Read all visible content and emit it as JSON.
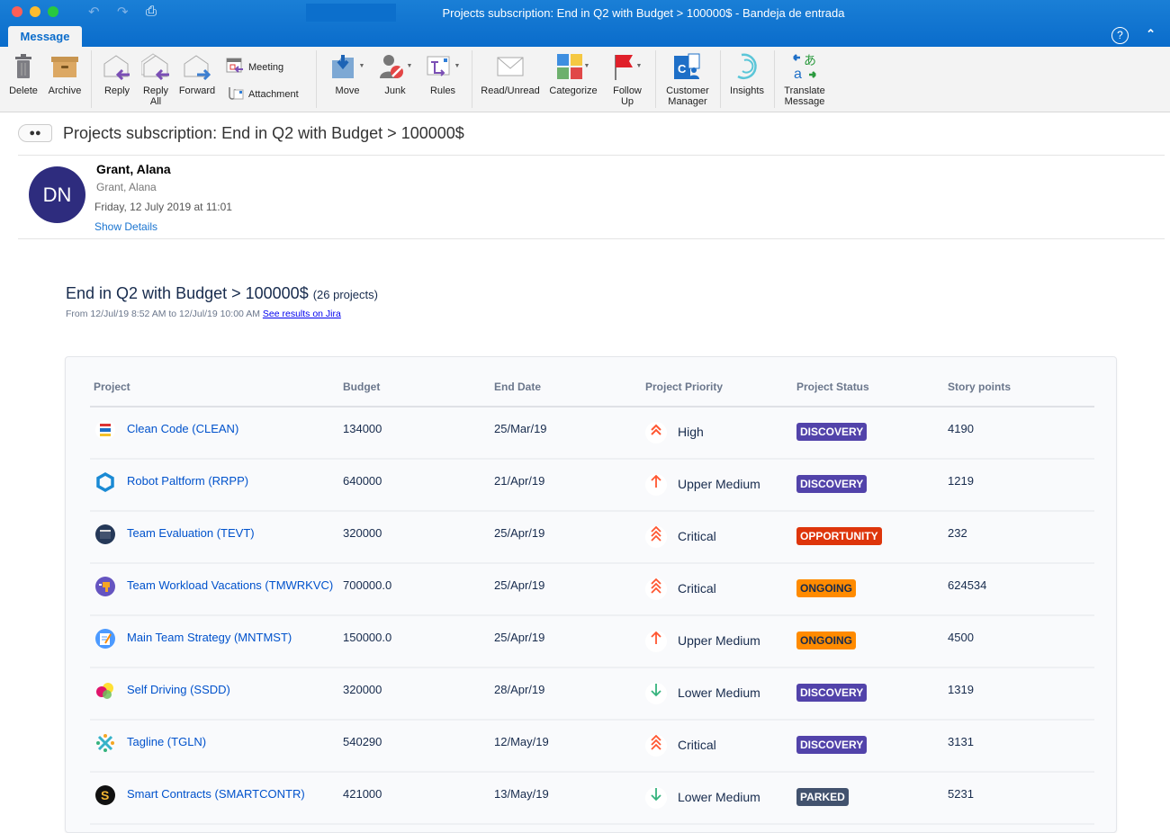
{
  "window": {
    "title": "Projects subscription: End in Q2 with Budget > 100000$ - Bandeja de entrada",
    "tab": "Message",
    "help_icon": "?",
    "collapse_icon": "^"
  },
  "ribbon": {
    "delete": "Delete",
    "archive": "Archive",
    "reply": "Reply",
    "reply_all_1": "Reply",
    "reply_all_2": "All",
    "forward": "Forward",
    "meeting": "Meeting",
    "attachment": "Attachment",
    "move": "Move",
    "junk": "Junk",
    "rules": "Rules",
    "read_unread": "Read/Unread",
    "categorize": "Categorize",
    "follow_up_1": "Follow",
    "follow_up_2": "Up",
    "customer_manager_1": "Customer",
    "customer_manager_2": "Manager",
    "insights": "Insights",
    "translate_1": "Translate",
    "translate_2": "Message"
  },
  "email": {
    "subject": "Projects subscription: End in Q2 with Budget > 100000$",
    "avatar_initials": "DN",
    "sender_name": "Grant, Alana",
    "sender_address": "Grant, Alana",
    "date": "Friday, 12 July 2019 at 11:01",
    "show_details": "Show Details"
  },
  "report": {
    "title": "End in Q2 with Budget > 100000$",
    "count": "(26 projects)",
    "range": "From 12/Jul/19 8:52 AM to 12/Jul/19 10:00 AM",
    "jira_link": "See results on Jira",
    "columns": [
      "Project",
      "Budget",
      "End Date",
      "Project Priority",
      "Project Status",
      "Story points"
    ],
    "rows": [
      {
        "name": "Clean Code (CLEAN)",
        "budget": "134000",
        "end": "25/Mar/19",
        "priority": "High",
        "prio_icon": "double-up",
        "status": "DISCOVERY",
        "points": "4190"
      },
      {
        "name": "Robot Paltform (RRPP)",
        "budget": "640000",
        "end": "21/Apr/19",
        "priority": "Upper Medium",
        "prio_icon": "up",
        "status": "DISCOVERY",
        "points": "1219"
      },
      {
        "name": "Team Evaluation (TEVT)",
        "budget": "320000",
        "end": "25/Apr/19",
        "priority": "Critical",
        "prio_icon": "triple-up",
        "status": "OPPORTUNITY",
        "points": "232"
      },
      {
        "name": "Team Workload Vacations (TMWRKVC)",
        "budget": "700000.0",
        "end": "25/Apr/19",
        "priority": "Critical",
        "prio_icon": "triple-up",
        "status": "ONGOING",
        "points": "624534"
      },
      {
        "name": "Main Team Strategy (MNTMST)",
        "budget": "150000.0",
        "end": "25/Apr/19",
        "priority": "Upper Medium",
        "prio_icon": "up",
        "status": "ONGOING",
        "points": "4500"
      },
      {
        "name": "Self Driving (SSDD)",
        "budget": "320000",
        "end": "28/Apr/19",
        "priority": "Lower Medium",
        "prio_icon": "down",
        "status": "DISCOVERY",
        "points": "1319"
      },
      {
        "name": "Tagline (TGLN)",
        "budget": "540290",
        "end": "12/May/19",
        "priority": "Critical",
        "prio_icon": "triple-up",
        "status": "DISCOVERY",
        "points": "3131"
      },
      {
        "name": "Smart Contracts (SMARTCONTR)",
        "budget": "421000",
        "end": "13/May/19",
        "priority": "Lower Medium",
        "prio_icon": "down",
        "status": "PARKED",
        "points": "5231"
      }
    ]
  },
  "colors": {
    "titlebar": "#0a6ccb",
    "discovery": "#5243aa",
    "opportunity": "#de350b",
    "ongoing": "#ff8b00",
    "parked": "#42526e",
    "priority_up": "#ff5630",
    "priority_down": "#36b37e",
    "link": "#0052cc"
  }
}
